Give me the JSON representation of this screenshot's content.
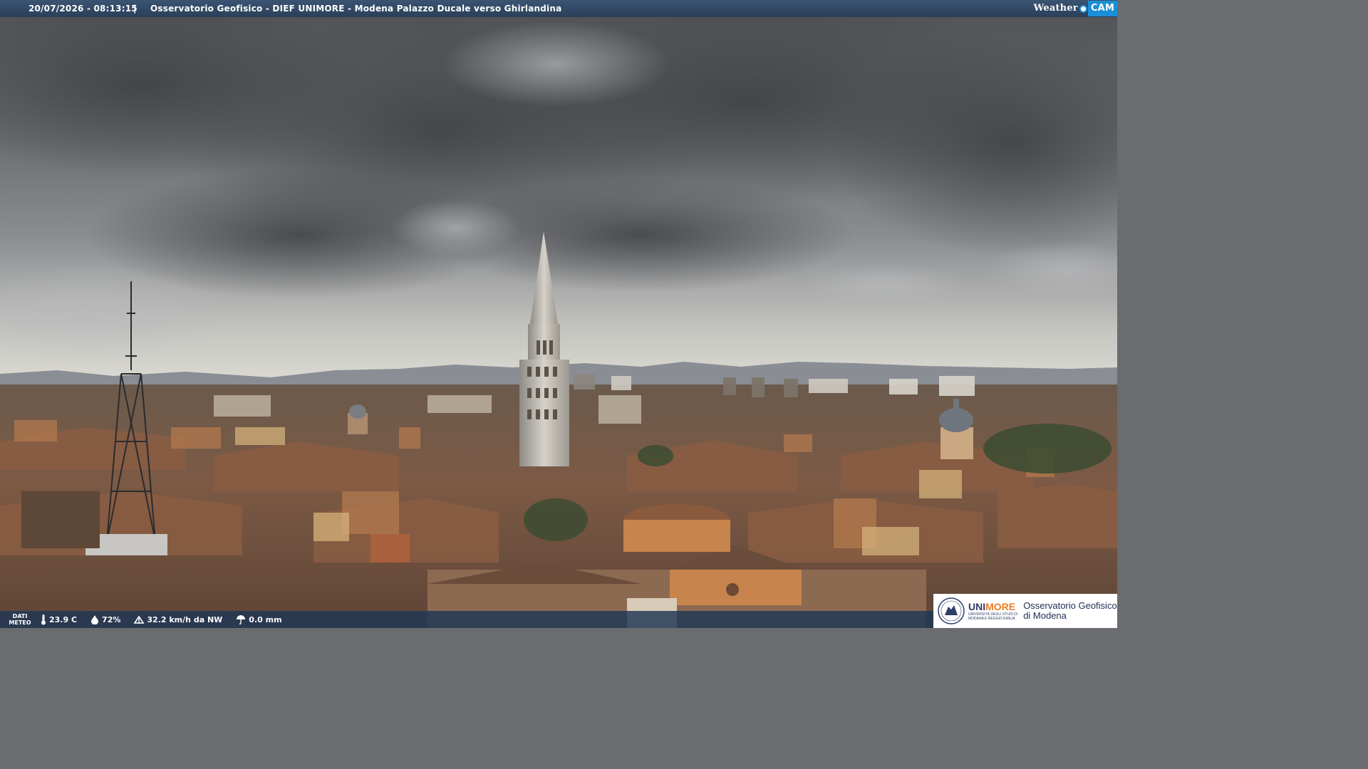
{
  "overlay": {
    "timestamp": "20/07/2026 - 08:13:15",
    "separator": "|",
    "location": "Osservatorio Geofisico - DIEF UNIMORE - Modena Palazzo Ducale verso Ghirlandina",
    "brand_weather": "Weather",
    "brand_cam": "CAM"
  },
  "weather": {
    "dati_label": "DATI\nMETEO",
    "temperature": "23.9 C",
    "humidity": "72%",
    "wind": "32.2 km/h da NW",
    "rain": "0.0 mm",
    "icons": [
      "thermometer-icon",
      "humidity-drop-icon",
      "wind-icon",
      "rain-icon"
    ]
  },
  "logo": {
    "uni_part1": "UNI",
    "uni_part2": "MORE",
    "uni_sub1": "UNIVERSITÀ DEGLI STUDI DI",
    "uni_sub2": "MODENA E REGGIO EMILIA",
    "observatory_line1": "Osservatorio Geofisico",
    "observatory_line2": "di Modena"
  },
  "colors": {
    "topbar": "#2f4664",
    "accent_blue": "#1a8fd8",
    "unimore_orange": "#ef7d23",
    "unimore_navy": "#2d3d6a"
  }
}
